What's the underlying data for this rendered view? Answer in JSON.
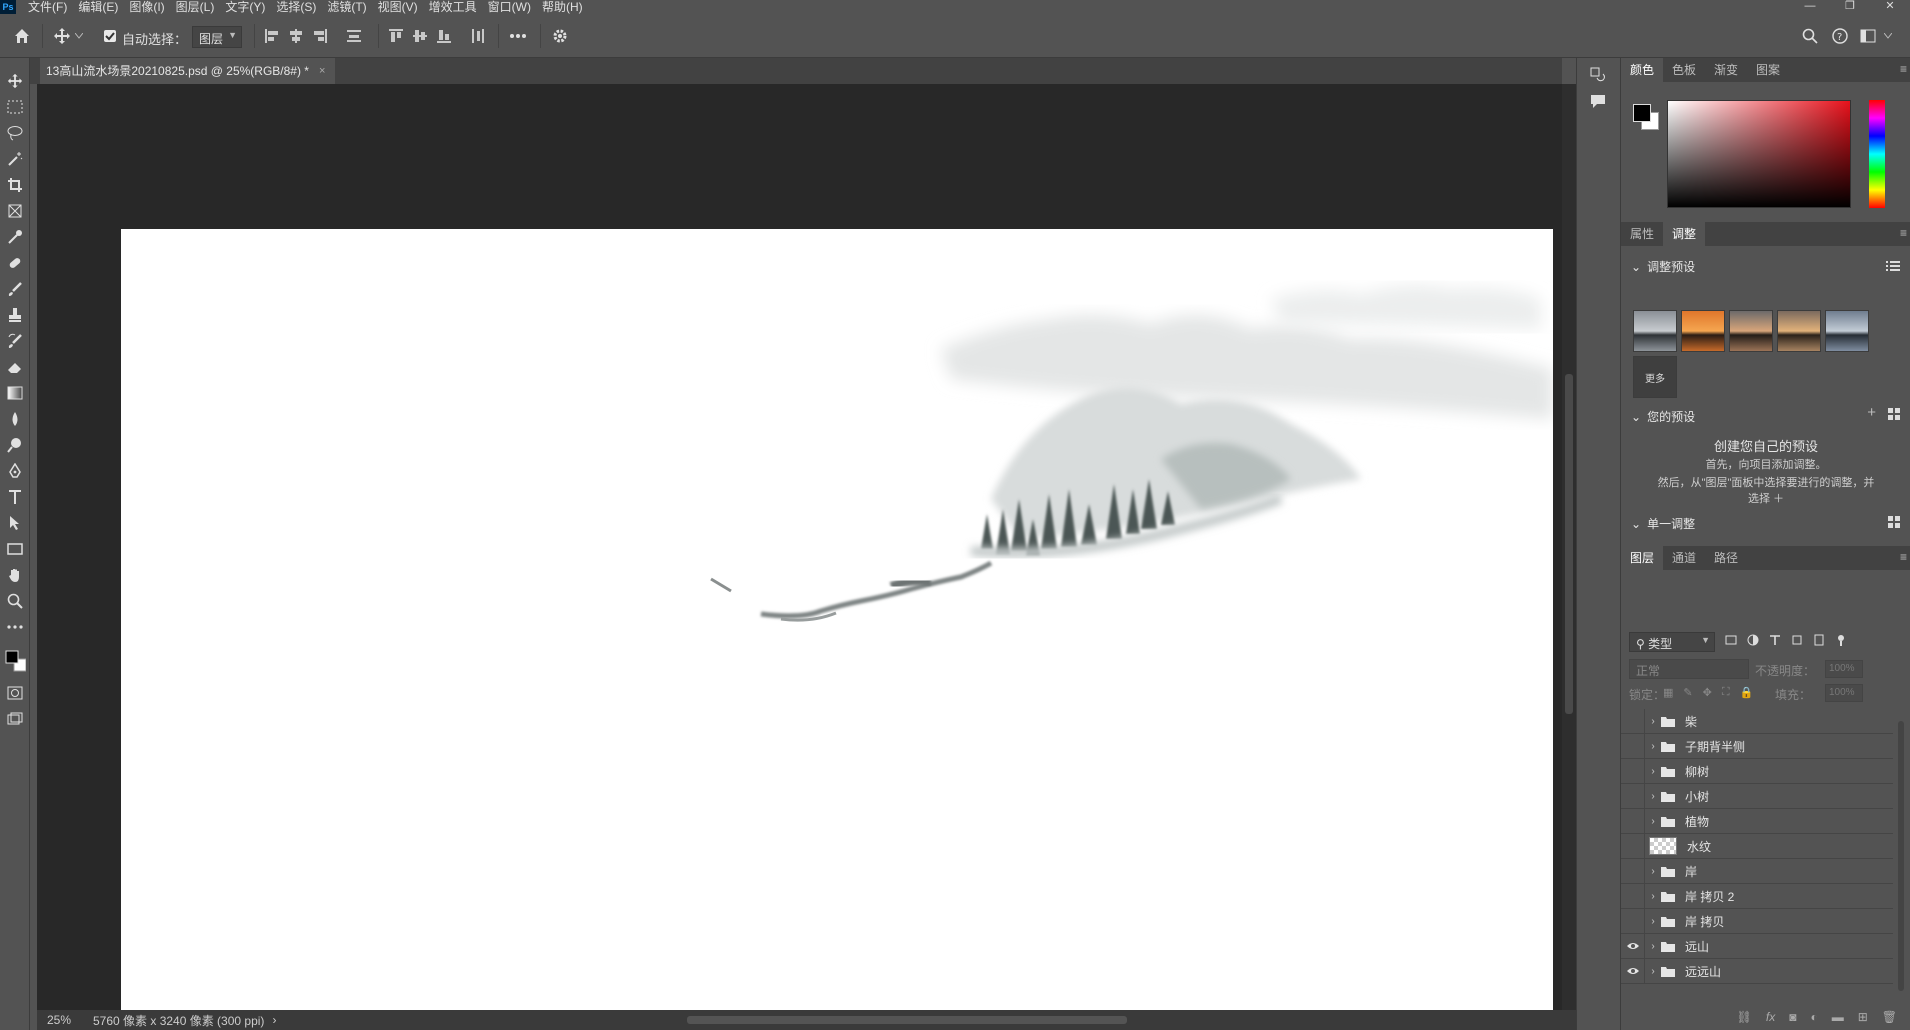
{
  "app": {
    "logo": "Ps"
  },
  "menu": [
    "文件(F)",
    "编辑(E)",
    "图像(I)",
    "图层(L)",
    "文字(Y)",
    "选择(S)",
    "滤镜(T)",
    "视图(V)",
    "增效工具",
    "窗口(W)",
    "帮助(H)"
  ],
  "window_controls": [
    "—",
    "❐",
    "✕"
  ],
  "options": {
    "auto_select_label": "自动选择：",
    "auto_select_checked": true,
    "layer_target": "图层"
  },
  "document": {
    "tab_title": "13高山流水场景20210825.psd @ 25%(RGB/8#) *",
    "close_glyph": "×"
  },
  "status": {
    "zoom": "25%",
    "info": "5760 像素 x 3240 像素 (300 ppi)",
    "arrow": "›"
  },
  "color_panel": {
    "tabs": [
      "颜色",
      "色板",
      "渐变",
      "图案"
    ],
    "active_tab": "颜色",
    "foreground": "#000000",
    "background": "#ffffff",
    "hue_color": "#e8111b"
  },
  "adjust_panel": {
    "tabs": [
      "属性",
      "调整"
    ],
    "active_tab": "调整",
    "presets_header": "调整预设",
    "more_label": "更多",
    "your_presets_header": "您的预设",
    "create_title": "创建您自己的预设",
    "create_line1": "首先，向项目添加调整。",
    "create_line2": "然后，从\"图层\"面板中选择要进行的调整，并",
    "create_line3": "选择 ＋",
    "single_adjust_header": "单一调整"
  },
  "layers_panel": {
    "tabs": [
      "图层",
      "通道",
      "路径"
    ],
    "active_tab": "图层",
    "filter_kind": "类型",
    "blend_mode": "正常",
    "opacity_label": "不透明度：",
    "opacity_value": "100%",
    "lock_label": "锁定：",
    "fill_label": "填充：",
    "fill_value": "100%",
    "layers": [
      {
        "name": "柴",
        "type": "group",
        "visible": false
      },
      {
        "name": "子期背半侧",
        "type": "group",
        "visible": false
      },
      {
        "name": "柳树",
        "type": "group",
        "visible": false
      },
      {
        "name": "小树",
        "type": "group",
        "visible": false
      },
      {
        "name": "植物",
        "type": "group",
        "visible": false
      },
      {
        "name": "水纹",
        "type": "pixel",
        "visible": false
      },
      {
        "name": "岸",
        "type": "group",
        "visible": false
      },
      {
        "name": "岸 拷贝 2",
        "type": "group",
        "visible": false
      },
      {
        "name": "岸 拷贝",
        "type": "group",
        "visible": false
      },
      {
        "name": "远山",
        "type": "group",
        "visible": true
      },
      {
        "name": "远远山",
        "type": "group",
        "visible": true
      }
    ],
    "footer_fx": "fx"
  }
}
